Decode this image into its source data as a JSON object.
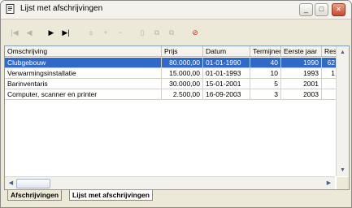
{
  "window": {
    "title": "Lijst met afschrijvingen"
  },
  "toolbar": {
    "buttons": [
      {
        "icon": "first-record-icon",
        "glyph": "|◀",
        "enabled": false
      },
      {
        "icon": "previous-record-icon",
        "glyph": "◀",
        "enabled": false
      },
      {
        "icon": "next-record-icon",
        "glyph": "▶",
        "enabled": true
      },
      {
        "icon": "last-record-icon",
        "glyph": "▶|",
        "enabled": true
      },
      {
        "icon": "insert-row-icon",
        "glyph": "±",
        "enabled": false
      },
      {
        "icon": "add-row-icon",
        "glyph": "+",
        "enabled": false
      },
      {
        "icon": "delete-row-icon",
        "glyph": "−",
        "enabled": false
      },
      {
        "icon": "calculator-icon",
        "glyph": "▯",
        "enabled": false
      },
      {
        "icon": "copy-records-icon",
        "glyph": "⧉",
        "enabled": false
      },
      {
        "icon": "paste-records-icon",
        "glyph": "⧉",
        "enabled": false
      },
      {
        "icon": "stop-icon",
        "glyph": "⊘",
        "enabled": true,
        "color": "#c8281e"
      }
    ]
  },
  "table": {
    "columns": [
      "Omschrijving",
      "Prijs",
      "Datum",
      "Termijnen",
      "Eerste jaar",
      "Res"
    ],
    "rows": [
      {
        "omschrijving": "Clubgebouw",
        "prijs": "80.000,00",
        "datum": "01-01-1990",
        "termijnen": "40",
        "eerste_jaar": "1990",
        "res": "62",
        "selected": true
      },
      {
        "omschrijving": "Verwarmingsinstallatie",
        "prijs": "15.000,00",
        "datum": "01-01-1993",
        "termijnen": "10",
        "eerste_jaar": "1993",
        "res": "1",
        "selected": false
      },
      {
        "omschrijving": "Barinventaris",
        "prijs": "30.000,00",
        "datum": "15-01-2001",
        "termijnen": "5",
        "eerste_jaar": "2001",
        "res": "",
        "selected": false
      },
      {
        "omschrijving": "Computer, scanner en printer",
        "prijs": "2.500,00",
        "datum": "16-09-2003",
        "termijnen": "3",
        "eerste_jaar": "2003",
        "res": "",
        "selected": false
      }
    ]
  },
  "tabs": [
    "Afschrijvingen",
    "Lijst met afschrijvingen"
  ],
  "colors": {
    "selection": "#3169c6",
    "grid_border": "#7f9db9"
  }
}
